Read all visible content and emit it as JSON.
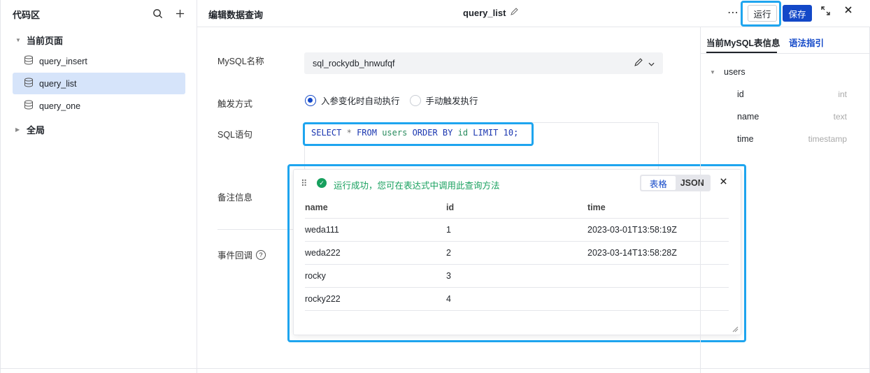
{
  "left_panel": {
    "title": "代码区",
    "groups": [
      {
        "label": "当前页面",
        "expanded": true,
        "items": [
          {
            "label": "query_insert",
            "active": false
          },
          {
            "label": "query_list",
            "active": true
          },
          {
            "label": "query_one",
            "active": false
          }
        ]
      },
      {
        "label": "全局",
        "expanded": false
      }
    ]
  },
  "header": {
    "title": "编辑数据查询",
    "query_name": "query_list",
    "run_label": "运行",
    "save_label": "保存",
    "more_label": "⋯"
  },
  "form": {
    "mysql_label": "MySQL名称",
    "mysql_value": "sql_rockydb_hnwufqf",
    "trigger_label": "触发方式",
    "trigger_options": [
      {
        "label": "入参变化时自动执行",
        "selected": true
      },
      {
        "label": "手动触发执行",
        "selected": false
      }
    ],
    "sql_label": "SQL语句",
    "sql_tokens": {
      "select": "SELECT",
      "star": "*",
      "from": "FROM",
      "table": "users",
      "order": "ORDER BY",
      "col": "id",
      "limit": "LIMIT",
      "num": "10;"
    },
    "remark_label": "备注信息",
    "callback_label": "事件回调",
    "help_glyph": "?"
  },
  "result": {
    "success_message": "运行成功，您可在表达式中调用此查询方法",
    "view_table_label": "表格",
    "view_json_label": "JSON",
    "columns": [
      "name",
      "id",
      "time"
    ],
    "rows": [
      [
        "weda111",
        "1",
        "2023-03-01T13:58:19Z"
      ],
      [
        "weda222",
        "2",
        "2023-03-14T13:58:28Z"
      ],
      [
        "rocky",
        "3",
        ""
      ],
      [
        "rocky222",
        "4",
        ""
      ]
    ]
  },
  "right_panel": {
    "tab_info": "当前MySQL表信息",
    "tab_guide": "语法指引",
    "table_name": "users",
    "fields": [
      {
        "name": "id",
        "type": "int"
      },
      {
        "name": "name",
        "type": "text"
      },
      {
        "name": "time",
        "type": "timestamp"
      }
    ]
  },
  "colors": {
    "primary": "#1348c8",
    "success": "#17a05e",
    "highlight": "#1ea5ef",
    "active_item": "#d6e4fa"
  }
}
